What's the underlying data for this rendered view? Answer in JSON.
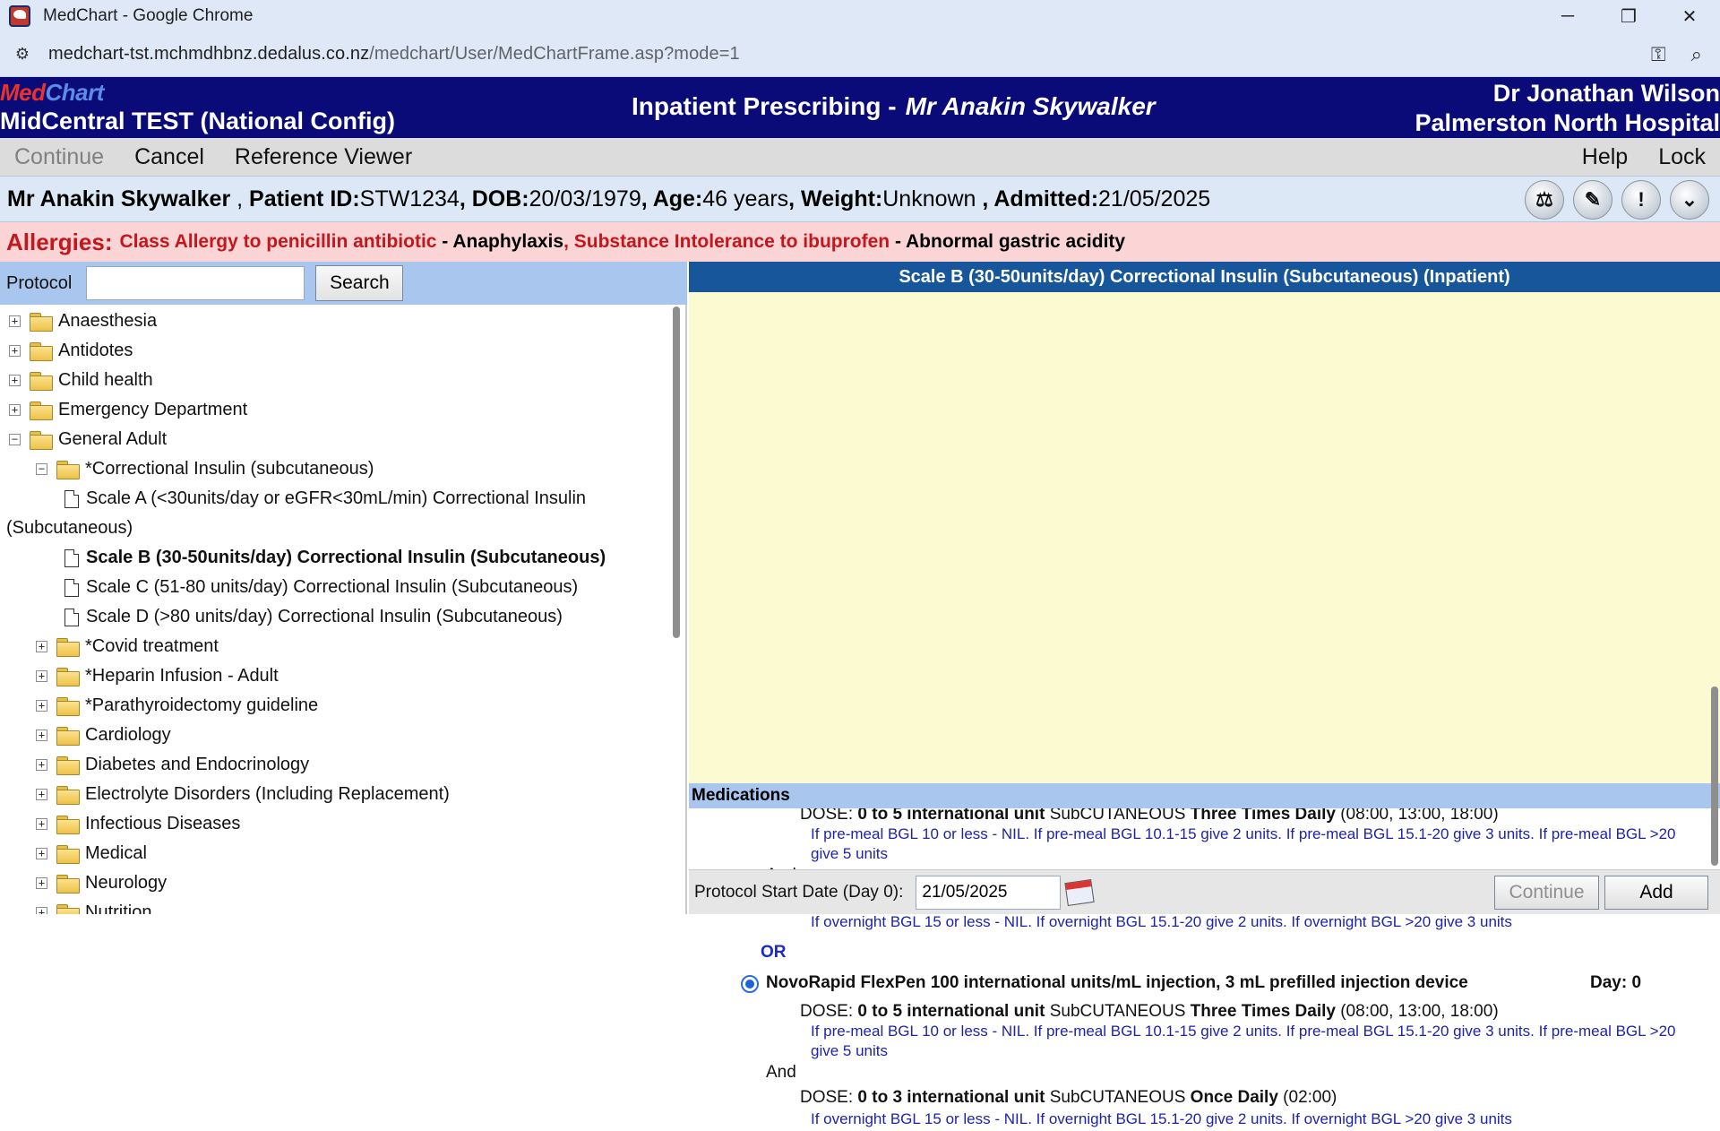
{
  "browser": {
    "window_title": "MedChart - Google Chrome",
    "url_host": "medchart-tst.mchmdhbnz.dedalus.co.nz",
    "url_path": "/medchart/User/MedChartFrame.asp?mode=1",
    "controls": {
      "minimize": "─",
      "restore": "❐",
      "close": "✕"
    }
  },
  "header": {
    "logo_med": "Med",
    "logo_chart": "Chart",
    "org": "MidCentral TEST (National Config)",
    "module": "Inpatient Prescribing -",
    "patient_name": "Mr Anakin Skywalker",
    "doctor": "Dr Jonathan Wilson",
    "hospital": "Palmerston North Hospital"
  },
  "menu": {
    "continue": "Continue",
    "cancel": "Cancel",
    "reference_viewer": "Reference Viewer",
    "help": "Help",
    "lock": "Lock"
  },
  "patient": {
    "name": "Mr Anakin Skywalker",
    "sep1": " , ",
    "id_label": "Patient ID:",
    "id_value": "STW1234",
    "dob_label": ", DOB:",
    "dob_value": "20/03/1979",
    "age_label": ", Age:",
    "age_value": "46 years",
    "weight_label": ", Weight:",
    "weight_value": "Unknown",
    "admitted_label": " , Admitted:",
    "admitted_value": "21/05/2025"
  },
  "allergies": {
    "label": "Allergies:",
    "item1": "Class Allergy to penicillin antibiotic",
    "reaction1": " - Anaphylaxis",
    "item2": ", Substance Intolerance to ibuprofen",
    "reaction2": " - Abnormal gastric acidity"
  },
  "search": {
    "label": "Protocol",
    "value": "",
    "button": "Search"
  },
  "tree": [
    {
      "label": "Anaesthesia",
      "type": "folder",
      "expander": "+",
      "depth": 0
    },
    {
      "label": "Antidotes",
      "type": "folder",
      "expander": "+",
      "depth": 0
    },
    {
      "label": "Child health",
      "type": "folder",
      "expander": "+",
      "depth": 0
    },
    {
      "label": "Emergency Department",
      "type": "folder",
      "expander": "+",
      "depth": 0
    },
    {
      "label": "General Adult",
      "type": "folder",
      "expander": "−",
      "depth": 0
    },
    {
      "label": "*Correctional Insulin (subcutaneous)",
      "type": "folder",
      "expander": "−",
      "depth": 1
    },
    {
      "label": "Scale A (<30units/day or eGFR<30mL/min) Correctional Insulin",
      "label2": "(Subcutaneous)",
      "type": "doc",
      "depth": 2
    },
    {
      "label": "Scale B (30-50units/day) Correctional Insulin (Subcutaneous)",
      "type": "doc",
      "depth": 2,
      "selected": true
    },
    {
      "label": "Scale C (51-80 units/day) Correctional Insulin (Subcutaneous)",
      "type": "doc",
      "depth": 2
    },
    {
      "label": "Scale D (>80 units/day) Correctional Insulin (Subcutaneous)",
      "type": "doc",
      "depth": 2
    },
    {
      "label": "*Covid treatment",
      "type": "folder",
      "expander": "+",
      "depth": 1
    },
    {
      "label": "*Heparin Infusion - Adult",
      "type": "folder",
      "expander": "+",
      "depth": 1
    },
    {
      "label": "*Parathyroidectomy guideline",
      "type": "folder",
      "expander": "+",
      "depth": 1
    },
    {
      "label": "Cardiology",
      "type": "folder",
      "expander": "+",
      "depth": 1
    },
    {
      "label": "Diabetes and Endocrinology",
      "type": "folder",
      "expander": "+",
      "depth": 1
    },
    {
      "label": "Electrolyte Disorders (Including Replacement)",
      "type": "folder",
      "expander": "+",
      "depth": 1
    },
    {
      "label": "Infectious Diseases",
      "type": "folder",
      "expander": "+",
      "depth": 1
    },
    {
      "label": "Medical",
      "type": "folder",
      "expander": "+",
      "depth": 1
    },
    {
      "label": "Neurology",
      "type": "folder",
      "expander": "+",
      "depth": 1
    },
    {
      "label": "Nutrition",
      "type": "folder",
      "expander": "+",
      "depth": 1
    }
  ],
  "protocol": {
    "title": "Scale B (30-50units/day) Correctional Insulin (Subcutaneous) (Inpatient)",
    "medications_label": "Medications",
    "dose_prefix": "DOSE:",
    "dose1_amount": "0 to 5 international unit",
    "route": "SubCUTANEOUS",
    "freq1": "Three Times Daily",
    "times1": "(08:00, 13:00, 18:00)",
    "note1": "If pre-meal BGL 10 or less - NIL. If pre-meal BGL 10.1-15 give 2 units. If pre-meal BGL 15.1-20 give 3 units. If pre-meal BGL >20 give 5 units",
    "and_label": "And",
    "dose2_amount": "0 to 3 international unit",
    "freq2": "Once Daily",
    "times2": "(02:00)",
    "note2": "If overnight BGL 15 or less - NIL. If overnight BGL 15.1-20 give 2 units. If overnight BGL >20 give 3 units",
    "or_label": "OR",
    "med2_name": "NovoRapid FlexPen 100 international units/mL injection, 3 mL prefilled injection device",
    "med2_day": "Day: 0",
    "med2_selected": true
  },
  "footer": {
    "start_label": "Protocol Start Date (Day 0):",
    "start_value": "21/05/2025",
    "continue": "Continue",
    "add": "Add"
  }
}
